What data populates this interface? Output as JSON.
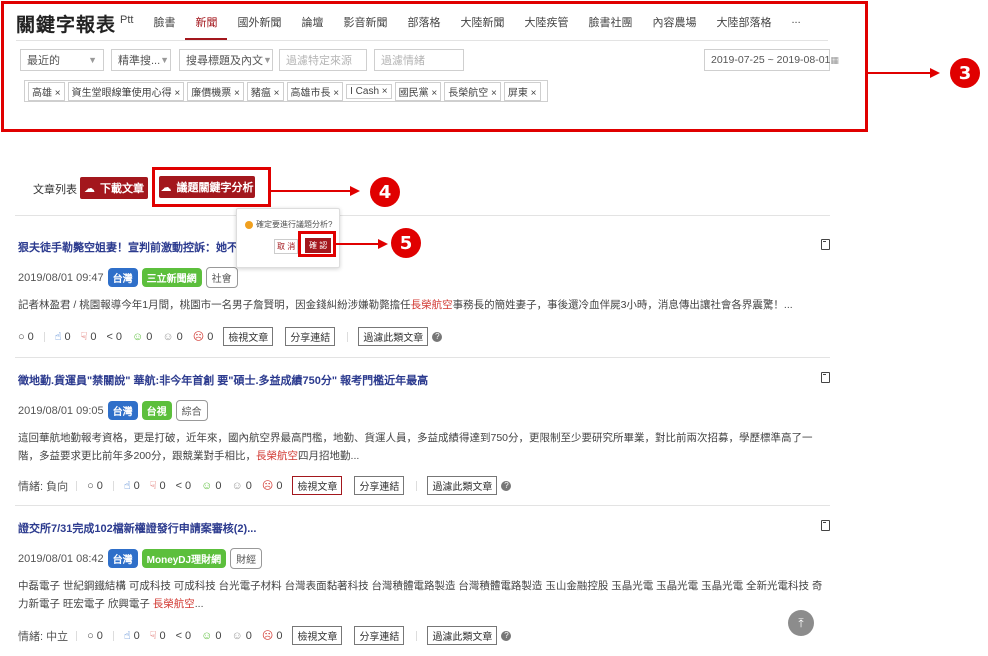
{
  "app": {
    "brand": "關鍵字報表"
  },
  "nav": {
    "items": [
      "Ptt",
      "臉書",
      "新聞",
      "國外新聞",
      "論壇",
      "影音新聞",
      "部落格",
      "大陸新聞",
      "大陸疾管",
      "臉書社團",
      "內容農場",
      "大陸部落格",
      "..."
    ],
    "active": "新聞"
  },
  "filters": {
    "sort": "最近的",
    "precision": "精準搜...",
    "search_scope": "搜尋標題及內文",
    "exclude_source_placeholder": "過濾特定來源",
    "exclude_sentiment_placeholder": "過濾情緒",
    "date_range": "2019-07-25 ~ 2019-08-01"
  },
  "keyword_tags": [
    "高雄",
    "資生堂眼線筆使用心得",
    "廉價機票",
    "豬瘟",
    "高雄市長",
    "I Cash",
    "國民黨",
    "長榮航空",
    "屏東"
  ],
  "toolbar": {
    "list_title": "文章列表",
    "download_label": "下載文章",
    "analysis_label": "議題關鍵字分析"
  },
  "popover": {
    "question": "確定要進行議題分析?",
    "cancel": "取 消",
    "confirm": "確 認"
  },
  "annotations": {
    "step3": "3",
    "step4": "4",
    "step5": "5"
  },
  "articles": [
    {
      "title": "狠夫徒手勒斃空姐妻！宣判前激動控訴：她不讓我好",
      "datetime": "2019/08/01 09:47",
      "region": "台灣",
      "source": "三立新聞網",
      "category": "社會",
      "body_before": "記者林盈君 / 桃園報導今年1月間，桃園市一名男子詹賢明，因金錢糾紛涉嫌勒斃擔任",
      "body_highlight": "長榮航空",
      "body_after": "事務長的簡姓妻子，事後還冷血伴屍3小時，消息傳出讓社會各界震驚！...",
      "sentiment": "",
      "stats": [
        "0",
        "0",
        "0",
        "0",
        "0",
        "0",
        "0"
      ],
      "btn_view": "檢視文章",
      "btn_share": "分享連結",
      "btn_filter": "過濾此類文章"
    },
    {
      "title": "徵地勤.貨運員\"禁關說\" 華航:非今年首創 要\"碩士.多益成績750分\" 報考門檻近年最高",
      "datetime": "2019/08/01 09:05",
      "region": "台灣",
      "source": "台視",
      "category": "綜合",
      "body_before": "這回華航地勤報考資格，更是打破，近年來，國內航空界最高門檻，地勤、貨運人員，多益成績得達到750分，更限制至少要研究所畢業，對比前兩次招募，學歷標準高了一階，多益要求更比前年多200分，跟競業對手相比，",
      "body_highlight": "長榮航空",
      "body_after": "四月招地勤...",
      "sentiment": "情緒: 負向",
      "stats": [
        "0",
        "0",
        "0",
        "0",
        "0",
        "0",
        "0"
      ],
      "btn_view": "檢視文章",
      "btn_share": "分享連結",
      "btn_filter": "過濾此類文章"
    },
    {
      "title": "證交所7/31完成102檔新權證發行申請案審核(2)...",
      "datetime": "2019/08/01 08:42",
      "region": "台灣",
      "source": "MoneyDJ理財網",
      "category": "財經",
      "body_before": "中磊電子 世紀鋼鐵結構 可成科技 可成科技 台光電子材料 台灣表面黏著科技 台灣積體電路製造 台灣積體電路製造 玉山金融控股 玉晶光電 玉晶光電 玉晶光電 全新光電科技 奇力新電子 旺宏電子 欣興電子 ",
      "body_highlight": "長榮航空",
      "body_after": "...",
      "sentiment": "情緒: 中立",
      "stats": [
        "0",
        "0",
        "0",
        "0",
        "0",
        "0",
        "0"
      ],
      "btn_view": "檢視文章",
      "btn_share": "分享連結",
      "btn_filter": "過濾此類文章"
    }
  ],
  "colors": {
    "brand": "#a3171d",
    "annotation": "#e00000",
    "title_link": "#2c3b8f"
  }
}
